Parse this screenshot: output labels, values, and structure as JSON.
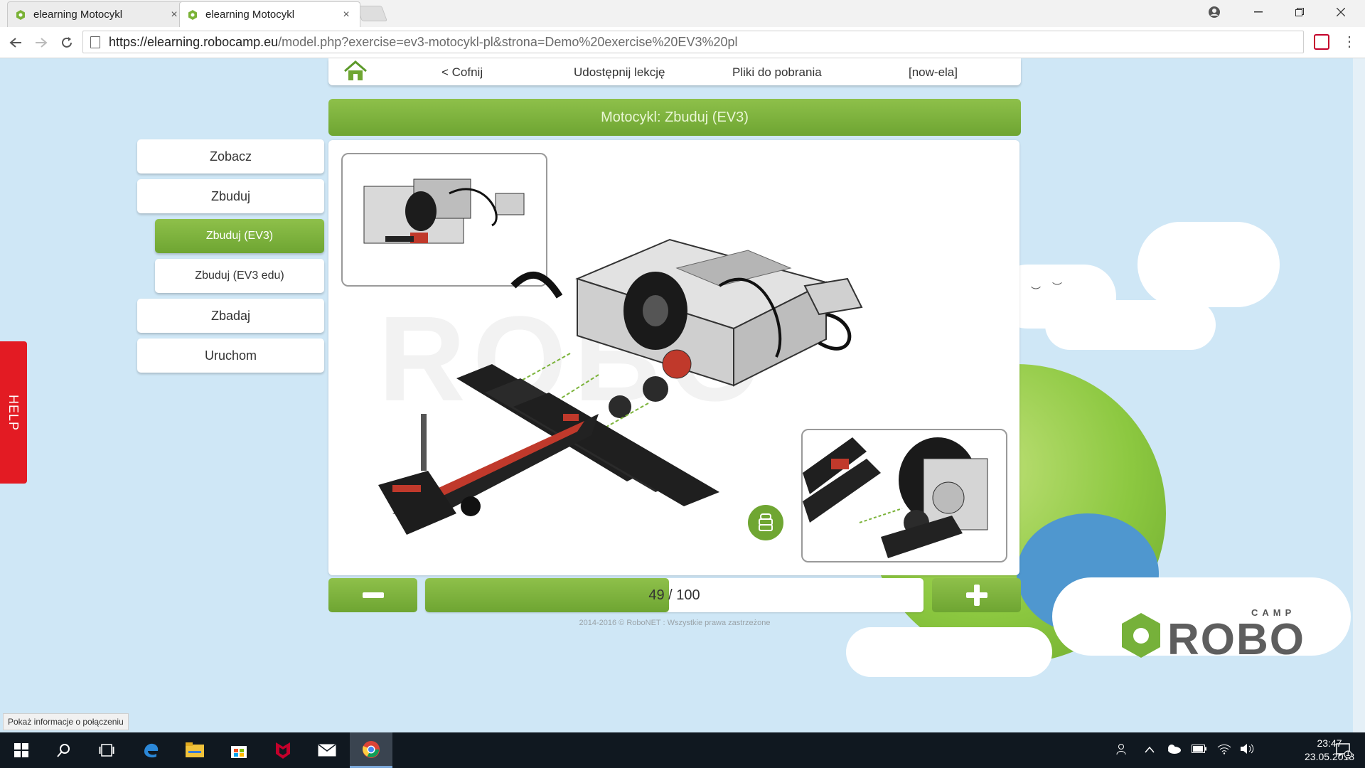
{
  "browser": {
    "tabs": [
      {
        "label": "elearning Motocykl",
        "close": "×",
        "active": false
      },
      {
        "label": "elearning Motocykl",
        "close": "×",
        "active": true
      }
    ],
    "url_host": "https://elearning.robocamp.eu",
    "url_rest": "/model.php?exercise=ev3-motocykl-pl&strona=Demo%20exercise%20EV3%20pl",
    "status_tooltip": "Pokaż informacje o połączeniu"
  },
  "topnav": {
    "back": "< Cofnij",
    "share": "Udostępnij lekcję",
    "downloads": "Pliki do pobrania",
    "user": "[now-ela]"
  },
  "title": "Motocykl: Zbuduj (EV3)",
  "sidebar": {
    "items": [
      {
        "label": "Zobacz"
      },
      {
        "label": "Zbuduj"
      },
      {
        "label": "Zbuduj (EV3)",
        "active": true
      },
      {
        "label": "Zbuduj (EV3 edu)"
      },
      {
        "label": "Zbadaj"
      },
      {
        "label": "Uruchom"
      }
    ]
  },
  "help": "HELP",
  "stage": {
    "watermark": "ROBO"
  },
  "progress": {
    "current": "49",
    "separator": "/",
    "total": "100",
    "fraction": 0.49
  },
  "copyright": "2014-2016 © RoboNET : Wszystkie prawa zastrzeżone",
  "logo": {
    "word": "ROBO",
    "camp": "CAMP"
  },
  "taskbar": {
    "time": "23:47",
    "date": "23.05.2018",
    "notifications": "1"
  },
  "colors": {
    "accent_green": "#78b03a",
    "help_red": "#e31b23",
    "background": "#cfe7f6"
  }
}
